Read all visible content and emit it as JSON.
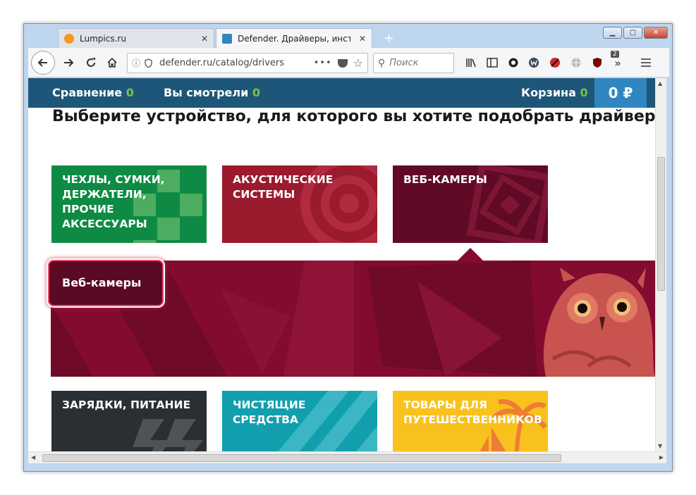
{
  "browser": {
    "tabs": [
      {
        "label": "Lumpics.ru",
        "close": "✕"
      },
      {
        "label": "Defender. Драйверы, инструкции",
        "close": "✕"
      }
    ],
    "new_tab": "+",
    "url": "defender.ru/catalog/drivers",
    "url_dots": "•••",
    "search_placeholder": "Поиск",
    "extension_badge": "2",
    "window_controls": {
      "minimize": "▁",
      "maximize": "▢",
      "close": "✕"
    }
  },
  "site": {
    "nav": {
      "compare_label": "Сравнение",
      "compare_count": "0",
      "viewed_label": "Вы смотрели",
      "viewed_count": "0",
      "cart_label": "Корзина",
      "cart_count": "0",
      "cart_total": "0 ₽"
    },
    "heading": "Выберите устройство, для которого вы хотите подобрать драйверы",
    "categories_row1": [
      {
        "label": "Чехлы, сумки, держатели, прочие аксессуары",
        "color": "#0e8a45"
      },
      {
        "label": "Акустические системы",
        "color": "#9a1a2e"
      },
      {
        "label": "Веб-камеры",
        "color": "#600a25"
      }
    ],
    "selected_sub": "Веб-камеры",
    "categories_row2": [
      {
        "label": "Зарядки, питание",
        "color": "#2a2f33"
      },
      {
        "label": "Чистящие средства",
        "color": "#119fae"
      },
      {
        "label": "Товары для путешественников",
        "color": "#f8c11e"
      }
    ],
    "colors": {
      "header": "#1d5678",
      "price_box": "#2f86c0",
      "count_green": "#7ec142",
      "banner": "#820b2f"
    }
  }
}
